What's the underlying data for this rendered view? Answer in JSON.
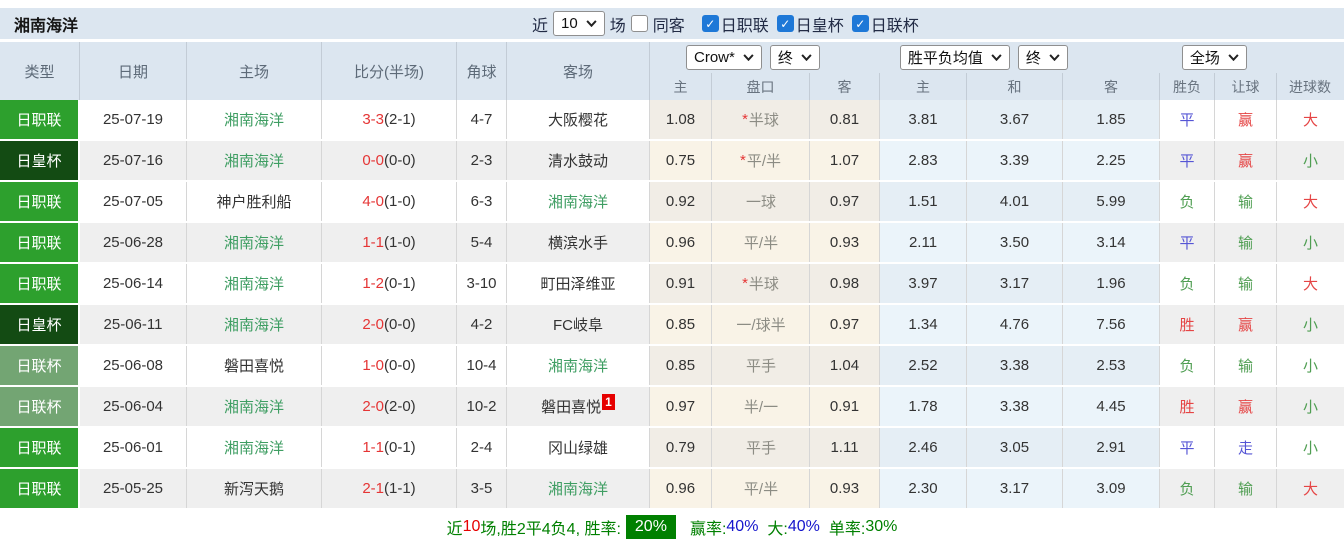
{
  "title": "湘南海洋",
  "topbar": {
    "recent_label": "近",
    "recent_value": "10",
    "matches_label": "场",
    "same_away_label": "同客",
    "same_away_checked": false,
    "leagues": [
      {
        "label": "日职联",
        "checked": true
      },
      {
        "label": "日皇杯",
        "checked": true
      },
      {
        "label": "日联杯",
        "checked": true
      }
    ]
  },
  "header": {
    "left_cols": [
      "类型",
      "日期",
      "主场",
      "比分(半场)",
      "角球",
      "客场"
    ],
    "dropdowns": {
      "bookmaker": "Crow*",
      "bookmaker_state": "终",
      "avg": "胜平负均值",
      "avg_state": "终",
      "scope": "全场"
    },
    "sub_cols": [
      "主",
      "盘口",
      "客",
      "主",
      "和",
      "客",
      "胜负",
      "让球",
      "进球数"
    ]
  },
  "rows": [
    {
      "league": "日职联",
      "date": "25-07-19",
      "home": "湘南海洋",
      "home_self": true,
      "score": "3-3",
      "half": "(2-1)",
      "corners": "4-7",
      "away": "大阪樱花",
      "away_self": false,
      "away_badge": "",
      "ah_star": true,
      "ah_home": "1.08",
      "ah_line": "半球",
      "ah_away": "0.81",
      "eu_home": "3.81",
      "eu_draw": "3.67",
      "eu_away": "1.85",
      "result": "平",
      "handicap": "赢",
      "goals": "大"
    },
    {
      "league": "日皇杯",
      "date": "25-07-16",
      "home": "湘南海洋",
      "home_self": true,
      "score": "0-0",
      "half": "(0-0)",
      "corners": "2-3",
      "away": "清水鼓动",
      "away_self": false,
      "away_badge": "",
      "ah_star": true,
      "ah_home": "0.75",
      "ah_line": "平/半",
      "ah_away": "1.07",
      "eu_home": "2.83",
      "eu_draw": "3.39",
      "eu_away": "2.25",
      "result": "平",
      "handicap": "赢",
      "goals": "小"
    },
    {
      "league": "日职联",
      "date": "25-07-05",
      "home": "神户胜利船",
      "home_self": false,
      "score": "4-0",
      "half": "(1-0)",
      "corners": "6-3",
      "away": "湘南海洋",
      "away_self": true,
      "away_badge": "",
      "ah_star": false,
      "ah_home": "0.92",
      "ah_line": "一球",
      "ah_away": "0.97",
      "eu_home": "1.51",
      "eu_draw": "4.01",
      "eu_away": "5.99",
      "result": "负",
      "handicap": "输",
      "goals": "大"
    },
    {
      "league": "日职联",
      "date": "25-06-28",
      "home": "湘南海洋",
      "home_self": true,
      "score": "1-1",
      "half": "(1-0)",
      "corners": "5-4",
      "away": "横滨水手",
      "away_self": false,
      "away_badge": "",
      "ah_star": false,
      "ah_home": "0.96",
      "ah_line": "平/半",
      "ah_away": "0.93",
      "eu_home": "2.11",
      "eu_draw": "3.50",
      "eu_away": "3.14",
      "result": "平",
      "handicap": "输",
      "goals": "小"
    },
    {
      "league": "日职联",
      "date": "25-06-14",
      "home": "湘南海洋",
      "home_self": true,
      "score": "1-2",
      "half": "(0-1)",
      "corners": "3-10",
      "away": "町田泽维亚",
      "away_self": false,
      "away_badge": "",
      "ah_star": true,
      "ah_home": "0.91",
      "ah_line": "半球",
      "ah_away": "0.98",
      "eu_home": "3.97",
      "eu_draw": "3.17",
      "eu_away": "1.96",
      "result": "负",
      "handicap": "输",
      "goals": "大"
    },
    {
      "league": "日皇杯",
      "date": "25-06-11",
      "home": "湘南海洋",
      "home_self": true,
      "score": "2-0",
      "half": "(0-0)",
      "corners": "4-2",
      "away": "FC岐阜",
      "away_self": false,
      "away_badge": "",
      "ah_star": false,
      "ah_home": "0.85",
      "ah_line": "一/球半",
      "ah_away": "0.97",
      "eu_home": "1.34",
      "eu_draw": "4.76",
      "eu_away": "7.56",
      "result": "胜",
      "handicap": "赢",
      "goals": "小"
    },
    {
      "league": "日联杯",
      "date": "25-06-08",
      "home": "磐田喜悦",
      "home_self": false,
      "score": "1-0",
      "half": "(0-0)",
      "corners": "10-4",
      "away": "湘南海洋",
      "away_self": true,
      "away_badge": "",
      "ah_star": false,
      "ah_home": "0.85",
      "ah_line": "平手",
      "ah_away": "1.04",
      "eu_home": "2.52",
      "eu_draw": "3.38",
      "eu_away": "2.53",
      "result": "负",
      "handicap": "输",
      "goals": "小"
    },
    {
      "league": "日联杯",
      "date": "25-06-04",
      "home": "湘南海洋",
      "home_self": true,
      "score": "2-0",
      "half": "(2-0)",
      "corners": "10-2",
      "away": "磐田喜悦",
      "away_self": false,
      "away_badge": "1",
      "ah_star": false,
      "ah_home": "0.97",
      "ah_line": "半/一",
      "ah_away": "0.91",
      "eu_home": "1.78",
      "eu_draw": "3.38",
      "eu_away": "4.45",
      "result": "胜",
      "handicap": "赢",
      "goals": "小"
    },
    {
      "league": "日职联",
      "date": "25-06-01",
      "home": "湘南海洋",
      "home_self": true,
      "score": "1-1",
      "half": "(0-1)",
      "corners": "2-4",
      "away": "冈山绿雄",
      "away_self": false,
      "away_badge": "",
      "ah_star": false,
      "ah_home": "0.79",
      "ah_line": "平手",
      "ah_away": "1.11",
      "eu_home": "2.46",
      "eu_draw": "3.05",
      "eu_away": "2.91",
      "result": "平",
      "handicap": "走",
      "goals": "小"
    },
    {
      "league": "日职联",
      "date": "25-05-25",
      "home": "新泻天鹅",
      "home_self": false,
      "score": "2-1",
      "half": "(1-1)",
      "corners": "3-5",
      "away": "湘南海洋",
      "away_self": true,
      "away_badge": "",
      "ah_star": false,
      "ah_home": "0.96",
      "ah_line": "平/半",
      "ah_away": "0.93",
      "eu_home": "2.30",
      "eu_draw": "3.17",
      "eu_away": "3.09",
      "result": "负",
      "handicap": "输",
      "goals": "大"
    }
  ],
  "summary": {
    "part1_green": "近",
    "part1_red": "10",
    "part1_rest": "场,胜2平4负4, 胜率:",
    "win_rate_badge": "20%",
    "handicap_label": "赢率:",
    "handicap_value": "40%",
    "big_label": "大:",
    "big_value": "40%",
    "single_label": "单率:",
    "single_value": "30%"
  },
  "colors": {
    "header_bg": "#dce6f0",
    "checkbox_blue": "#1e78d7",
    "league_j1": "#2da02d",
    "league_emperor": "#134b13",
    "league_cup": "#73a573",
    "team_self": "#3f9e63",
    "score_red": "#e53535",
    "handicap_text": "#8c8c84",
    "win": "#e54545",
    "draw": "#5555d5",
    "loss": "#4f9e52",
    "badge_red": "#e60000",
    "summary_green": "#008000",
    "link_blue": "#1515cc"
  }
}
